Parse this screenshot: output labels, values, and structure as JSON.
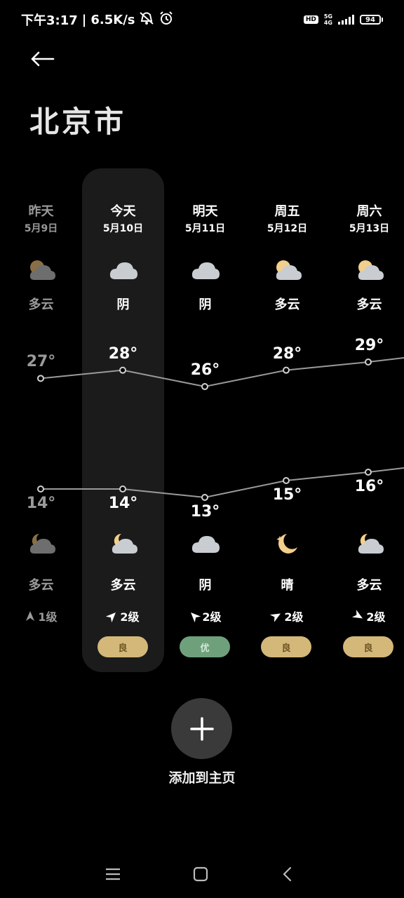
{
  "status_bar": {
    "time": "下午3:17",
    "separator": "|",
    "speed": "6.5K/s",
    "hd": "HD",
    "network_top": "5G",
    "network_bottom": "4G",
    "battery": "94",
    "icons": [
      "mute-vibrate-icon",
      "alarm-icon",
      "signal-icon",
      "battery-icon"
    ]
  },
  "header": {
    "back_icon": "back-arrow-icon",
    "city": "北京市"
  },
  "days": [
    {
      "name": "昨天",
      "date": "5月9日",
      "cond_day": "多云",
      "icon_day": "partly-cloudy-day-icon",
      "high": "27°",
      "low": "14°",
      "icon_night": "partly-cloudy-night-icon",
      "cond_night": "多云",
      "wind": "1级",
      "wind_dir_deg": 0,
      "aqi": "",
      "past": true
    },
    {
      "name": "今天",
      "date": "5月10日",
      "cond_day": "阴",
      "icon_day": "cloudy-icon",
      "high": "28°",
      "low": "14°",
      "icon_night": "partly-cloudy-night-icon",
      "cond_night": "多云",
      "wind": "2级",
      "wind_dir_deg": 45,
      "aqi": "良",
      "past": false
    },
    {
      "name": "明天",
      "date": "5月11日",
      "cond_day": "阴",
      "icon_day": "cloudy-icon",
      "high": "26°",
      "low": "13°",
      "icon_night": "cloudy-icon",
      "cond_night": "阴",
      "wind": "2级",
      "wind_dir_deg": -45,
      "aqi": "优",
      "past": false
    },
    {
      "name": "周五",
      "date": "5月12日",
      "cond_day": "多云",
      "icon_day": "partly-cloudy-day-icon",
      "high": "28°",
      "low": "15°",
      "icon_night": "moon-icon",
      "cond_night": "晴",
      "wind": "2级",
      "wind_dir_deg": 60,
      "aqi": "良",
      "past": false
    },
    {
      "name": "周六",
      "date": "5月13日",
      "cond_day": "多云",
      "icon_day": "partly-cloudy-day-icon",
      "high": "29°",
      "low": "16°",
      "icon_night": "partly-cloudy-night-icon",
      "cond_night": "多云",
      "wind": "2级",
      "wind_dir_deg": 120,
      "aqi": "良",
      "past": false
    }
  ],
  "chart_data": {
    "type": "line",
    "categories": [
      "5月9日",
      "5月10日",
      "5月11日",
      "5月12日",
      "5月13日"
    ],
    "series": [
      {
        "values": [
          27,
          28,
          26,
          28,
          29
        ]
      },
      {
        "values": [
          14,
          14,
          13,
          15,
          16
        ]
      }
    ]
  },
  "colors": {
    "aqi_good": "#d4b87a",
    "aqi_excellent": "#6fa07c",
    "aqi_good_text": "#6b5420",
    "aqi_excellent_text": "#cfe9d4",
    "line": "#9a9a9a"
  },
  "add_button": {
    "icon": "plus-icon",
    "label": "添加到主页"
  },
  "nav": [
    "menu-icon",
    "home-icon",
    "back-icon"
  ]
}
